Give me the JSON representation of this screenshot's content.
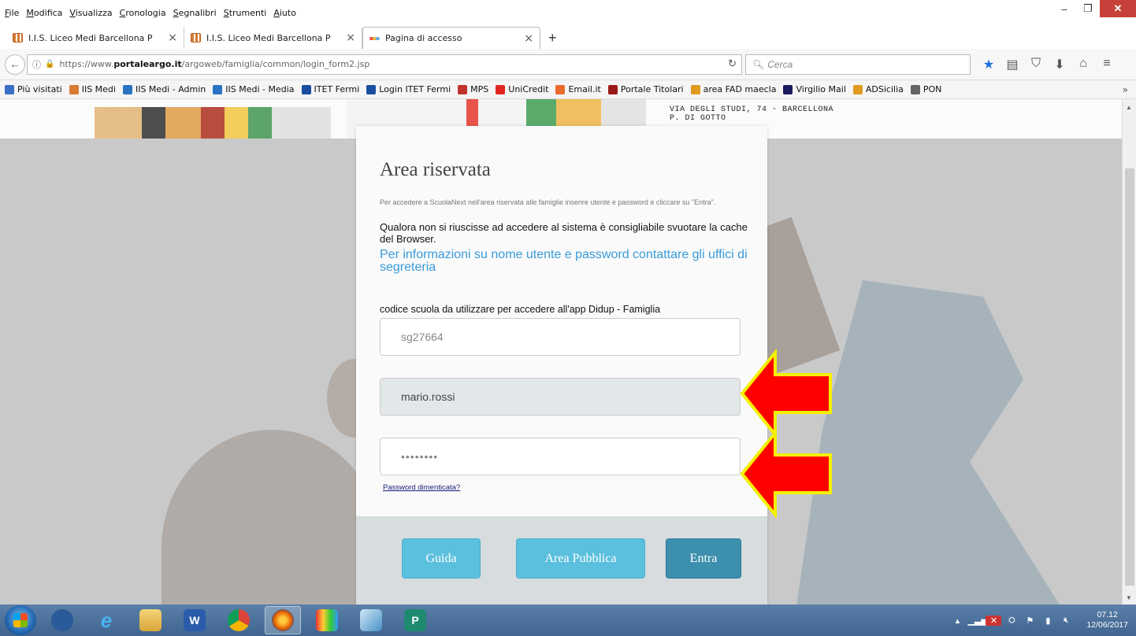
{
  "browser": {
    "menu": [
      "File",
      "Modifica",
      "Visualizza",
      "Cronologia",
      "Segnalibri",
      "Strumenti",
      "Aiuto"
    ],
    "tabs": [
      {
        "label": "I.I.S. Liceo Medi Barcellona P",
        "close": "×",
        "active": false
      },
      {
        "label": "I.I.S. Liceo Medi Barcellona P",
        "close": "×",
        "active": false
      },
      {
        "label": "Pagina di accesso",
        "close": "×",
        "active": true
      }
    ],
    "new_tab": "+",
    "url_prefix": "https://www.",
    "url_domain": "portaleargo.it",
    "url_path": "/argoweb/famiglia/common/login_form2.jsp",
    "search_placeholder": "Cerca",
    "bookmarks": [
      {
        "label": "Più visitati",
        "color": "#3a6fc4"
      },
      {
        "label": "IIS Medi",
        "color": "#d87b33"
      },
      {
        "label": "IIS Medi - Admin",
        "color": "#2a73c0"
      },
      {
        "label": "IIS Medi - Media",
        "color": "#2a73c0"
      },
      {
        "label": "ITET Fermi",
        "color": "#1a4fa0"
      },
      {
        "label": "Login ITET Fermi",
        "color": "#1a4fa0"
      },
      {
        "label": "MPS",
        "color": "#c0322e"
      },
      {
        "label": "UniCredit",
        "color": "#e0261f"
      },
      {
        "label": "Email.it",
        "color": "#e96a2d"
      },
      {
        "label": "Portale Titolari",
        "color": "#9a1a1a"
      },
      {
        "label": "area FAD maecla",
        "color": "#e09a20"
      },
      {
        "label": "Virgilio Mail",
        "color": "#1a1a60"
      },
      {
        "label": "ADSicilia",
        "color": "#e09a20"
      },
      {
        "label": "PON",
        "color": "#666666"
      }
    ],
    "bookmarks_more": "»"
  },
  "page": {
    "school_address_line1": "VIA DEGLI STUDI, 74 - BARCELLONA",
    "school_address_line2": "P. DI GOTTO",
    "title": "Area riservata",
    "intro": "Per accedere a ScuolaNext nell'area riservata alle famiglie inserire utente e password e cliccare su \"Entra\".",
    "cache_note": "Qualora non si riuscisse ad accedere al sistema è consigliabile svuotare la cache del Browser.",
    "info_link": "Per informazioni su nome utente e password contattare gli uffici di segreteria",
    "code_label": "codice scuola da utilizzare per accedere all'app Didup - Famiglia",
    "school_code": "sg27664",
    "username": "mario.rossi",
    "password_mask": "••••••••",
    "forgot": "Password dimenticata?",
    "buttons": {
      "guida": "Guida",
      "pubblica": "Area Pubblica",
      "entra": "Entra"
    }
  },
  "taskbar": {
    "time": "07.12",
    "date": "12/06/2017"
  },
  "colors": {
    "accent_button": "#5bc0de",
    "primary_button": "#3c8fad",
    "link": "#3a9ad9",
    "arrow_fill": "#ff0000",
    "arrow_stroke": "#f5f000"
  }
}
